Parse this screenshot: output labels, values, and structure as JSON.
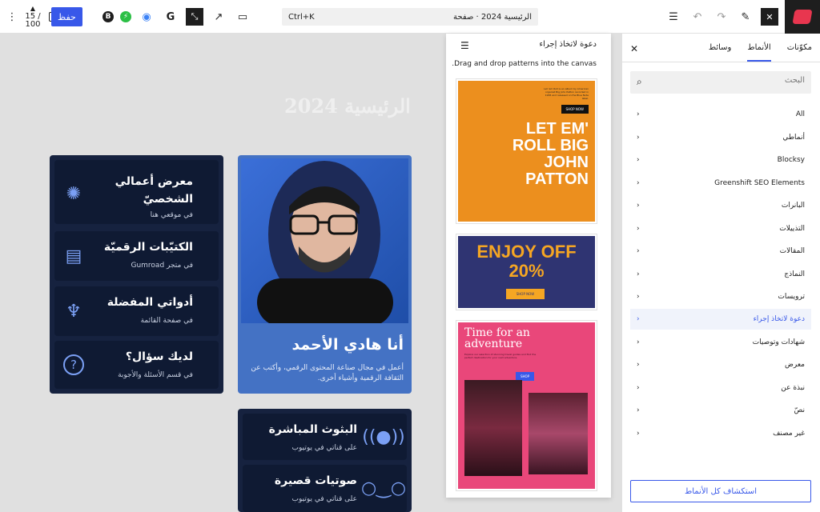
{
  "topbar": {
    "save_label": "حفظ",
    "counter_top": "15 /",
    "counter_bottom": "100",
    "search_shortcut": "Ctrl+K",
    "document_title": "الرئيسية 2024 · صفحة"
  },
  "canvas": {
    "page_title": "الرئيسية 2024",
    "profile": {
      "name": "أنا هادي الأحمد",
      "bio": "أعمل في مجال صناعة المحتوى الرقمي، وأكتب عن الثقافة الرقمية وأشياء أخرى."
    },
    "links": [
      {
        "title": "معرض أعمالي الشخصيّ",
        "subtitle": "في موقعي هنا",
        "icon": "star-badge-icon"
      },
      {
        "title": "الكتيّبات الرقميّة",
        "subtitle": "في متجر Gumroad",
        "icon": "book-icon"
      },
      {
        "title": "أدواتي المفضلة",
        "subtitle": "في صفحة القائمة",
        "icon": "lamp-icon"
      },
      {
        "title": "لديك سؤال؟",
        "subtitle": "في قسم الأسئلة والأجوبة",
        "icon": "question-icon"
      }
    ],
    "links2": [
      {
        "title": "البثوث المباشرة",
        "subtitle": "على قناتي في يوتيوب",
        "icon": "broadcast-icon"
      },
      {
        "title": "صوتيات قصيرة",
        "subtitle": "على قناتي في يوتيوب",
        "icon": "voicemail-icon"
      }
    ]
  },
  "patterns_panel": {
    "title": "دعوة لاتخاذ إجراء",
    "hint": "Drag and drop patterns into the canvas.",
    "previews": [
      {
        "small_text": "Let 'em Roll is an album by American organist Big John Patton recorded in 1965 and released on the Blue Note label.",
        "button": "SHOP NOW",
        "headline": "LET EM' ROLL BIG JOHN PATTON",
        "bg": "#ec8f1e"
      },
      {
        "headline": "ENJOY OFF 20%",
        "button": "SHOP NOW",
        "bg": "#2f3472"
      },
      {
        "headline": "Time for an adventure",
        "small_text": "Explore our selection of stunning travel guides and find the perfect destination for your next adventure.",
        "button": "SHOP",
        "bg": "#e9477a"
      }
    ]
  },
  "sidebar": {
    "tabs": [
      "مكوّنات",
      "الأنماط",
      "وسائط"
    ],
    "active_tab": "الأنماط",
    "search_placeholder": "البحث",
    "categories": [
      "All",
      "أنماطي",
      "Blocksy",
      "Greenshift SEO Elements",
      "البانرات",
      "التذييلات",
      "المقالات",
      "النماذج",
      "ترويسات",
      "دعوة لاتخاذ إجراء",
      "شهادات وتوصيات",
      "معرض",
      "نبذة عن",
      "نصّ",
      "غير مصنف"
    ],
    "active_category": "دعوة لاتخاذ إجراء",
    "explore_button": "استكشاف كل الأنماط"
  },
  "colors": {
    "accent": "#3858e9",
    "card_dark": "#16223f",
    "profile_blue": "#4472c4"
  }
}
